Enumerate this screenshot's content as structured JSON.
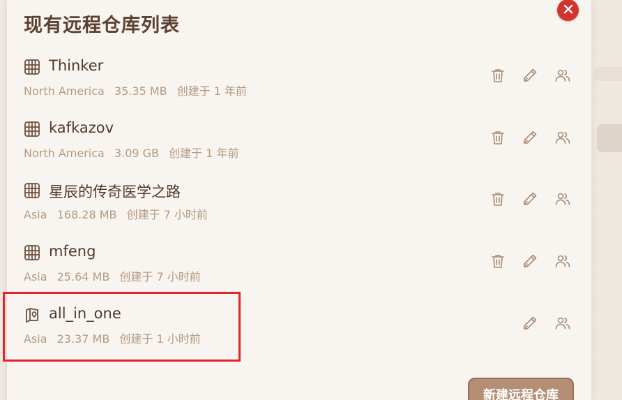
{
  "dialog": {
    "title": "现有远程仓库列表",
    "close_icon": "close-icon",
    "new_button_label": "新建远程仓库"
  },
  "colors": {
    "close_button": "#d1342f",
    "highlight_border": "#e3242b",
    "accent_button": "#b48f76",
    "title_text": "#5a4131",
    "meta_text": "#b49a82"
  },
  "repos": [
    {
      "name": "Thinker",
      "region": "North America",
      "size": "35.35 MB",
      "created": "创建于 1 年前",
      "icon": "grid-icon",
      "can_delete": true
    },
    {
      "name": "kafkazov",
      "region": "North America",
      "size": "3.09 GB",
      "created": "创建于 1 年前",
      "icon": "grid-icon",
      "can_delete": true
    },
    {
      "name": "星辰的传奇医学之路",
      "region": "Asia",
      "size": "168.28 MB",
      "created": "创建于 7 小时前",
      "icon": "grid-icon",
      "can_delete": true
    },
    {
      "name": "mfeng",
      "region": "Asia",
      "size": "25.64 MB",
      "created": "创建于 7 小时前",
      "icon": "grid-icon",
      "can_delete": true
    },
    {
      "name": "all_in_one",
      "region": "Asia",
      "size": "23.37 MB",
      "created": "创建于 1 小时前",
      "icon": "map-pin-icon",
      "can_delete": false
    }
  ]
}
